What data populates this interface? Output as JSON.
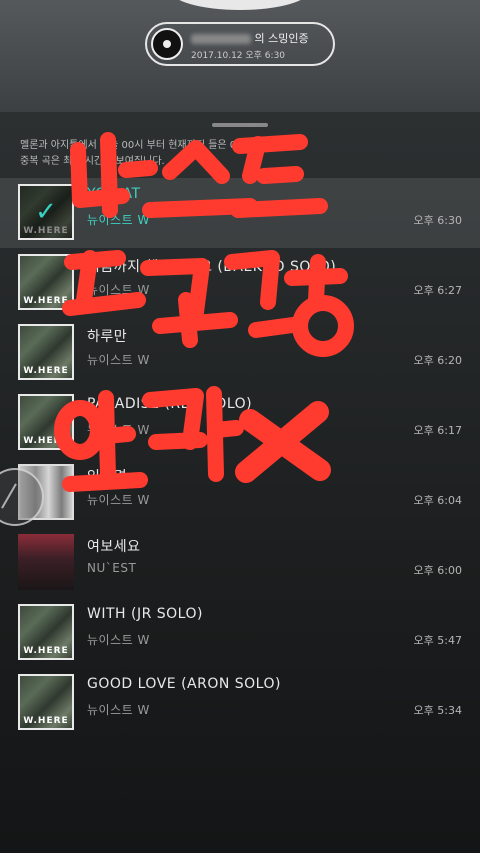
{
  "top": {
    "pill_title_suffix": "의 스밍인증",
    "pill_subtitle": "2017.10.12 오후 6:30"
  },
  "notice": {
    "line1": "멜론과 아지툴에서 오늘 00시 부터 현재까지 들은 00곡 입니다.",
    "line2": "중복 곡은 최근 시간만 보여집니다."
  },
  "songs": [
    {
      "title": "YOU AT",
      "artist": "뉴이스트 W",
      "time": "오후 6:30",
      "art": "wh",
      "selected": true
    },
    {
      "title": "지금까지 행복했어요 (BAEKHO SOLO)",
      "artist": "뉴이스트 W",
      "time": "오후 6:27",
      "art": "wh"
    },
    {
      "title": "하루만",
      "artist": "뉴이스트 W",
      "time": "오후 6:20",
      "art": "wh"
    },
    {
      "title": "PARADISE (REN SOLO)",
      "artist": "뉴이스트 W",
      "time": "오후 6:17",
      "art": "wh"
    },
    {
      "title": "있다면",
      "artist": "뉴이스트 W",
      "time": "오후 6:04",
      "art": "group"
    },
    {
      "title": "여보세요",
      "artist": "NU`EST",
      "time": "오후 6:00",
      "art": "hello"
    },
    {
      "title": "WITH (JR SOLO)",
      "artist": "뉴이스트 W",
      "time": "오후 5:47",
      "art": "wh"
    },
    {
      "title": "GOOD LOVE (ARON SOLO)",
      "artist": "뉴이스트 W",
      "time": "오후 5:34",
      "art": "wh"
    }
  ],
  "album_label": "W.HERE",
  "overlay_text": "뉴이스트 팬독점용 엔터X",
  "colors": {
    "accent": "#3fd0c0",
    "overlay_red": "#ff3b2f"
  },
  "icons": {
    "selected_check": "✓"
  }
}
